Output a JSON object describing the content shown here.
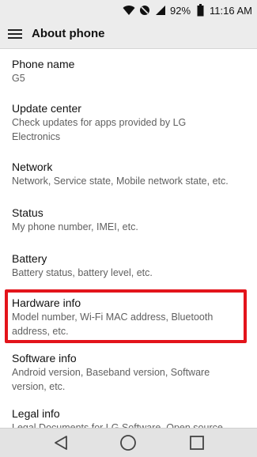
{
  "status_bar": {
    "icons": [
      "wifi-icon",
      "mute-icon",
      "signal-icon",
      "battery-icon"
    ],
    "battery_percent": "92%",
    "time": "11:16 AM"
  },
  "app_bar": {
    "menu_icon": "hamburger-menu-icon",
    "title": "About phone"
  },
  "items": [
    {
      "title": "Phone name",
      "subtitle": "G5"
    },
    {
      "title": "Update center",
      "subtitle_lines": [
        "Check updates for apps provided by LG",
        "Electronics"
      ]
    },
    {
      "title": "Network",
      "subtitle": "Network, Service state, Mobile network state, etc."
    },
    {
      "title": "Status",
      "subtitle": "My phone number, IMEI, etc."
    },
    {
      "title": "Battery",
      "subtitle": "Battery status, battery level, etc."
    },
    {
      "title": "Hardware info",
      "subtitle_lines": [
        "Model number, Wi-Fi MAC address, Bluetooth",
        "address, etc."
      ],
      "highlighted": true
    },
    {
      "title": "Software info",
      "subtitle_lines": [
        "Android version, Baseband version, Software",
        "version, etc."
      ]
    },
    {
      "title": "Legal info",
      "subtitle": "Legal Documents for LG Software, Open source"
    }
  ],
  "nav_bar": {
    "back_icon": "back-triangle-icon",
    "home_icon": "home-circle-icon",
    "recents_icon": "recents-square-icon"
  },
  "colors": {
    "highlight": "#e3141b",
    "bar_background": "#ececec",
    "nav_background": "#e3e3e3"
  }
}
